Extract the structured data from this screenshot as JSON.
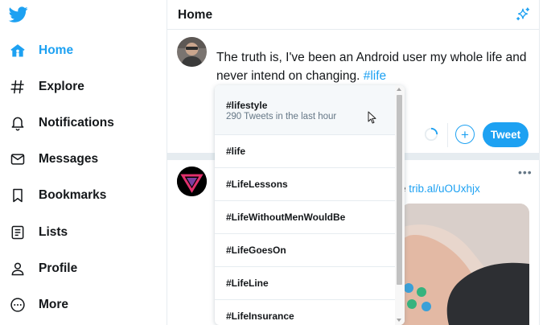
{
  "app": {
    "name": "Twitter",
    "accent": "#1da1f2"
  },
  "sidebar": {
    "items": [
      {
        "id": "home",
        "label": "Home",
        "icon": "home-icon",
        "active": true
      },
      {
        "id": "explore",
        "label": "Explore",
        "icon": "hashtag-icon"
      },
      {
        "id": "notifications",
        "label": "Notifications",
        "icon": "bell-icon"
      },
      {
        "id": "messages",
        "label": "Messages",
        "icon": "envelope-icon"
      },
      {
        "id": "bookmarks",
        "label": "Bookmarks",
        "icon": "bookmark-icon"
      },
      {
        "id": "lists",
        "label": "Lists",
        "icon": "list-icon"
      },
      {
        "id": "profile",
        "label": "Profile",
        "icon": "person-icon"
      },
      {
        "id": "more",
        "label": "More",
        "icon": "more-circle-icon"
      }
    ]
  },
  "header": {
    "title": "Home",
    "sparkle_icon": "sparkle-icon"
  },
  "composer": {
    "text": "The truth is, I've been an Android user my whole life and never intend on changing.",
    "hashtag": "#life",
    "tweet_button": "Tweet",
    "add_icon": "+"
  },
  "feed": {
    "tweet": {
      "link_prefix": "e",
      "link": "trib.al/uOUxhjx",
      "more_label": "•••"
    }
  },
  "autocomplete": {
    "items": [
      {
        "tag": "#lifestyle",
        "sub": "290 Tweets in the last hour"
      },
      {
        "tag": "#life"
      },
      {
        "tag": "#LifeLessons"
      },
      {
        "tag": "#LifeWithoutMenWouldBe"
      },
      {
        "tag": "#LifeGoesOn"
      },
      {
        "tag": "#LifeLine"
      },
      {
        "tag": "#LifeInsurance"
      }
    ]
  }
}
